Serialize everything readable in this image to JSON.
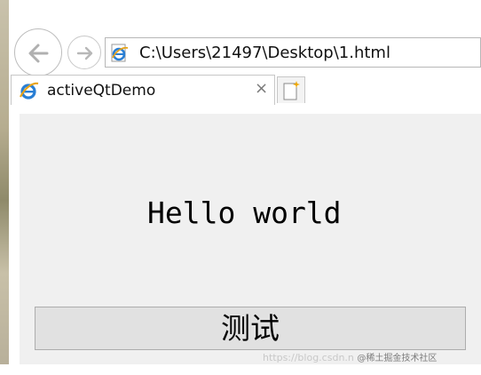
{
  "browser": {
    "address": "C:\\Users\\21497\\Desktop\\1.html",
    "tabs": [
      {
        "label": "activeQtDemo",
        "close_glyph": "×",
        "icon": "ie-icon"
      }
    ],
    "new_tab_icon": "new-tab-icon",
    "nav": {
      "back_icon": "back-arrow-icon",
      "forward_icon": "forward-arrow-icon"
    }
  },
  "page": {
    "greeting": "Hello world",
    "button_label": "测试"
  },
  "watermark": {
    "site": "https://blog.csdn.n",
    "brand": "@稀土掘金技术社区"
  },
  "colors": {
    "content_bg": "#f0f0f0",
    "button_bg": "#e1e1e1",
    "ie_blue": "#2a7fd4",
    "ie_orange": "#e8a317"
  }
}
